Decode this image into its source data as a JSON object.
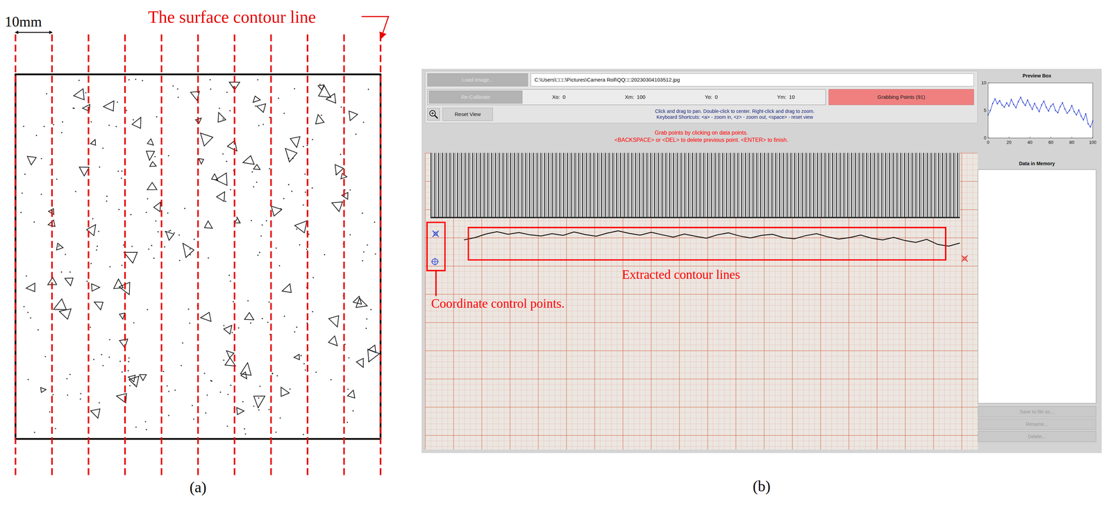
{
  "figure_a": {
    "scale_label": "10mm",
    "callout": "The surface contour line",
    "contour_lines": 11,
    "caption": "(a)"
  },
  "figure_b": {
    "caption": "(b)",
    "load_button": {
      "label": "Load Image...",
      "disabled": true
    },
    "file_path": "C:\\Users\\□□□\\Pictures\\Camera Roll\\QQ□□20230304103512.jpg",
    "recalibrate_button": {
      "label": "Re-Calibrate",
      "disabled": true
    },
    "calibration": [
      {
        "label": "Xo:",
        "value": "0"
      },
      {
        "label": "Xm:",
        "value": "100"
      },
      {
        "label": "Yo:",
        "value": "0"
      },
      {
        "label": "Ym:",
        "value": "10"
      }
    ],
    "grab_button": {
      "label": "Grabbing Points (91)",
      "active": true
    },
    "reset_button": {
      "label": "Reset View"
    },
    "help": [
      "Click and drag to pan. Double-click to center. Right-click and drag to zoom.",
      "Keyboard Shortcuts: <a> - zoom in, <z> - zoom out, <space> - reset view"
    ],
    "instructions": [
      "Grab points by clicking on data points.",
      "<BACKSPACE> or <DEL> to delete previous point. <ENTER> to finish."
    ],
    "annotations": {
      "contour": "Extracted contour lines",
      "control_points": "Coordinate control points."
    },
    "preview": {
      "title": "Preview Box",
      "x_ticks": [
        "0",
        "20",
        "40",
        "60",
        "80",
        "100"
      ],
      "y_ticks": [
        "0",
        "5",
        "10"
      ],
      "series": [
        4.2,
        5.0,
        6.3,
        7.1,
        6.2,
        6.8,
        6.0,
        5.6,
        6.4,
        5.8,
        7.0,
        6.1,
        5.5,
        6.6,
        7.4,
        6.5,
        5.9,
        6.9,
        6.0,
        5.2,
        6.3,
        5.5,
        4.8,
        6.0,
        6.7,
        5.6,
        4.9,
        5.8,
        6.2,
        5.0,
        4.6,
        5.7,
        6.4,
        5.3,
        4.5,
        5.0,
        5.9,
        4.8,
        4.2,
        5.1,
        4.0,
        3.3,
        4.4,
        2.6,
        2.0,
        3.1
      ]
    },
    "memory": {
      "title": "Data in Memory",
      "items": []
    },
    "side_buttons": [
      {
        "label": "Save to file as...",
        "disabled": true
      },
      {
        "label": "Rename...",
        "disabled": true
      },
      {
        "label": "Delete...",
        "disabled": true
      }
    ]
  }
}
